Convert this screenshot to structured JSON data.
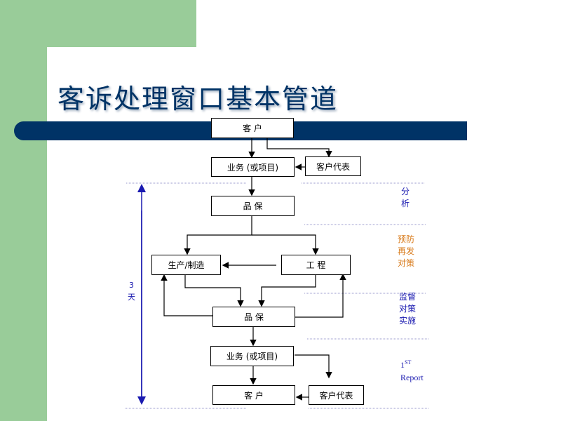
{
  "title": "客诉处理窗口基本管道",
  "boxes": {
    "customer_top": "客 户",
    "sales_top": "业务 (或项目)",
    "cust_rep_top": "客户代表",
    "qa_top": "品 保",
    "production": "生产/制造",
    "engineering": "工 程",
    "qa_mid": "品 保",
    "sales_bottom": "业务 (或项目)",
    "customer_bottom": "客 户",
    "cust_rep_bottom": "客户代表"
  },
  "timeline": {
    "days": "3",
    "unit": "天"
  },
  "phases": [
    {
      "lines": [
        "分",
        "析"
      ],
      "color": "#1a1ab0"
    },
    {
      "lines": [
        "预防",
        "再发",
        "对策"
      ],
      "color": "#d87a1a"
    },
    {
      "lines": [
        "监督",
        "对策",
        "实施"
      ],
      "color": "#1a1ab0"
    }
  ],
  "report": {
    "num": "1",
    "sup": "ST",
    "label": "Report"
  },
  "colors": {
    "green": "#99cc99",
    "navy": "#003366",
    "phase_blue": "#1a1ab0",
    "phase_orange": "#d87a1a"
  }
}
